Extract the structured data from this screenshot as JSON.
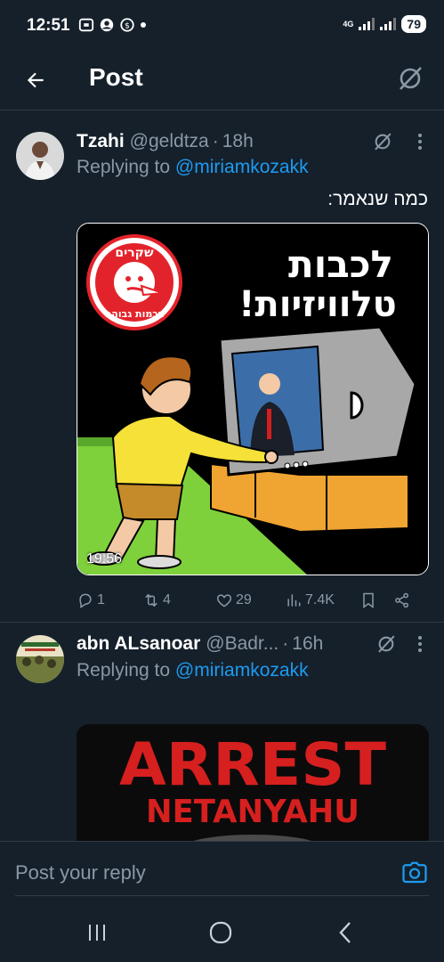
{
  "status_bar": {
    "time": "12:51",
    "network": "4G",
    "battery": "79"
  },
  "header": {
    "title": "Post"
  },
  "tweets": [
    {
      "name": "Tzahi",
      "handle": "@geldtza",
      "sep": "·",
      "time": "18h",
      "replying_prefix": "Replying to ",
      "replying_to": "@miriamkozakk",
      "text": "כמה שנאמר:",
      "media_text_line1": "לכבות",
      "media_text_line2": "טלוויזיות!",
      "stamp_top": "שקרים",
      "stamp_bottom": "בכמות גבוהה",
      "video_time": "19:56",
      "stats": {
        "replies": "1",
        "reposts": "4",
        "likes": "29",
        "views": "7.4K"
      }
    },
    {
      "name": "abn ALsanoar",
      "handle": "@Badr...",
      "sep": "·",
      "time": "16h",
      "replying_prefix": "Replying to ",
      "replying_to": "@miriamkozakk",
      "media_text_line1": "ARREST",
      "media_text_line2": "NETANYAHU"
    }
  ],
  "reply_bar": {
    "placeholder": "Post your reply"
  },
  "colors": {
    "background": "#15202b",
    "accent": "#1d9bf0",
    "muted": "#8b98a5"
  }
}
